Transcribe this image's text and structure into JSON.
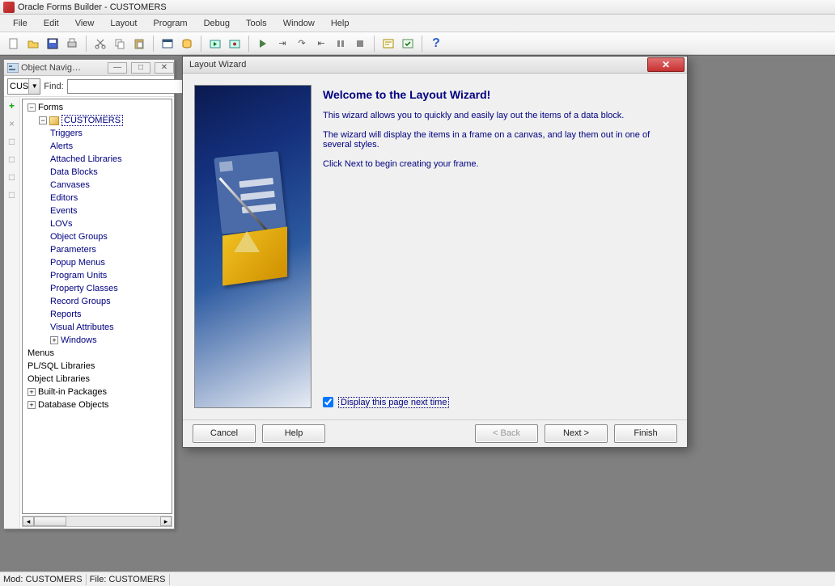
{
  "app": {
    "title": "Oracle Forms Builder - CUSTOMERS"
  },
  "menu": [
    "File",
    "Edit",
    "View",
    "Layout",
    "Program",
    "Debug",
    "Tools",
    "Window",
    "Help"
  ],
  "navigator": {
    "title": "Object Navig…",
    "combo_value": "CUS",
    "find_label": "Find:",
    "tree": {
      "root": "Forms",
      "module": "CUSTOMERS",
      "children": [
        "Triggers",
        "Alerts",
        "Attached Libraries",
        "Data Blocks",
        "Canvases",
        "Editors",
        "Events",
        "LOVs",
        "Object Groups",
        "Parameters",
        "Popup Menus",
        "Program Units",
        "Property Classes",
        "Record Groups",
        "Reports",
        "Visual Attributes",
        "Windows"
      ],
      "siblings": [
        "Menus",
        "PL/SQL Libraries",
        "Object Libraries",
        "Built-in Packages",
        "Database Objects"
      ]
    },
    "left_buttons": [
      "+",
      "×",
      "□",
      "□",
      "□",
      "□"
    ]
  },
  "wizard": {
    "title": "Layout Wizard",
    "heading": "Welcome to the Layout Wizard!",
    "p1": "This wizard allows you to quickly and easily lay out the items of a data block.",
    "p2": "The wizard will display the items in a frame on a canvas, and lay them out in one of several styles.",
    "p3": "Click Next to begin creating your frame.",
    "checkbox_label": "Display this page next time",
    "buttons": {
      "cancel": "Cancel",
      "help": "Help",
      "back": "< Back",
      "next": "Next >",
      "finish": "Finish"
    }
  },
  "status": {
    "mod": "Mod: CUSTOMERS",
    "file": "File: CUSTOMERS"
  }
}
